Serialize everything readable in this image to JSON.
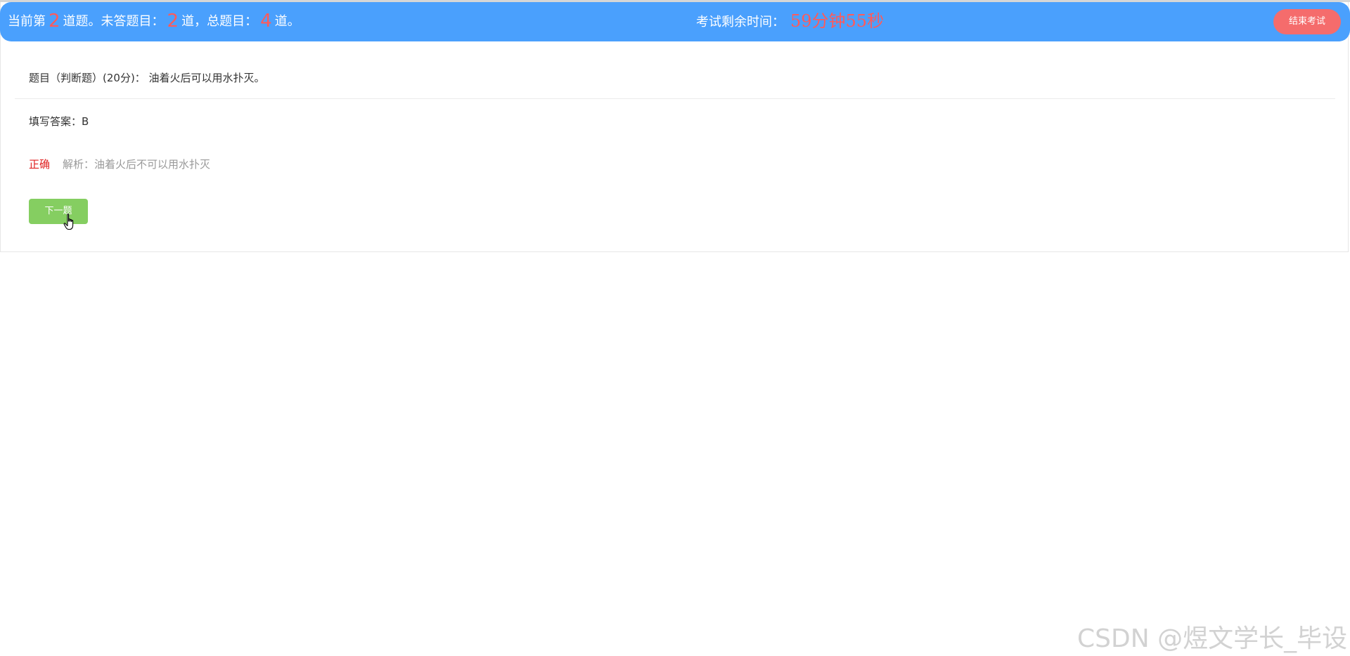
{
  "header": {
    "progress": {
      "prefix": "当前第",
      "current": "2",
      "mid1": "道题。未答题目：",
      "unanswered": "2",
      "mid2": "道，总题目：",
      "total": "4",
      "suffix": "道。"
    },
    "timer": {
      "label": "考试剩余时间：",
      "value": "59分钟55秒"
    },
    "end_button_label": "结束考试"
  },
  "question": {
    "text": "题目（判断题）(20分)： 油着火后可以用水扑灭。"
  },
  "answer": {
    "text": "填写答案：B"
  },
  "result": {
    "status": "正确",
    "analysis": "解析：油着火后不可以用水扑灭"
  },
  "next_button_label": "下一题",
  "watermark": "CSDN @煜文学长_毕设",
  "colors": {
    "header_bg": "#4aa0fd",
    "highlight_red": "#ff5a5a",
    "end_button": "#f56c6c",
    "next_button": "#85ce61",
    "status_red": "#e02020"
  }
}
